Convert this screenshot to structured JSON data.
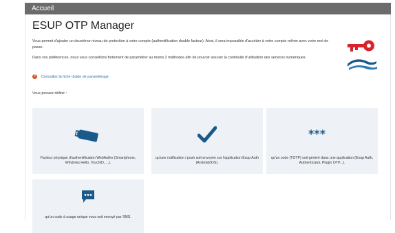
{
  "topbar": {
    "label": "Accueil"
  },
  "page": {
    "title": "ESUP OTP Manager"
  },
  "intro": {
    "paragraph1": "Vous permet d'ajouter un deuxième niveau de protection à votre compte (authentification double facteur). Ainsi, il sera impossible d'accéder à votre compte même avec votre mot de passe.",
    "paragraph2": "Dans vos préférences, nous vous conseillons fortement de paramétrer au moins 2 méthodes afin de pouvoir assurer la continuité d'utilisation des services numériques.",
    "help_link": "Consultez la fiche d'aide de paramétrage"
  },
  "define_label": "Vous pouvez définir :",
  "methods": [
    {
      "icon": "usb-key-icon",
      "text": "Facteur physique d'authentification WebAuthn (Smartphone, Windows Hello, TouchID, ...)."
    },
    {
      "icon": "checkmark-icon",
      "text": "qu'une notification / push soit envoyée sur l'application Esup Auth (Android/iOS)."
    },
    {
      "icon": "asterisks-icon",
      "text": "qu'un code (TOTP) soit généré dans une application (Esup Auth, Authenticator, Plugin OTP...)."
    },
    {
      "icon": "sms-icon",
      "text": "qu'un code à usage unique vous soit envoyé par SMS."
    }
  ],
  "colors": {
    "topbar": "#6b6b6b",
    "accent_blue": "#1a5a8a",
    "logo_red": "#d8232a",
    "help_orange": "#d9541e",
    "card_bg": "#eef2f6"
  }
}
